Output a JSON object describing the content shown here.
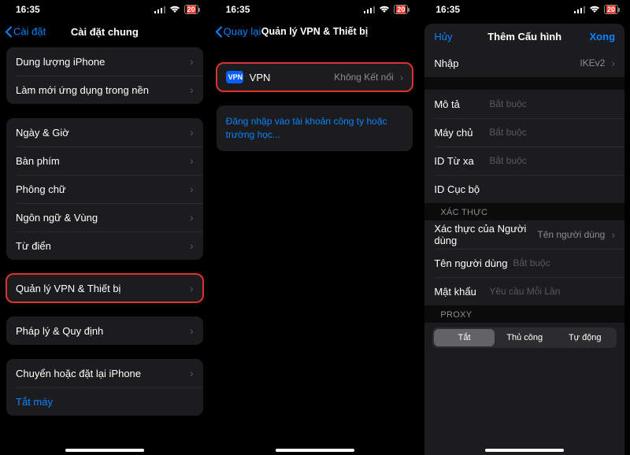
{
  "screen1": {
    "status": {
      "time": "16:35",
      "battery": "20"
    },
    "nav": {
      "back": "Cài đặt",
      "title": "Cài đặt chung"
    },
    "group1": [
      {
        "label": "Dung lượng iPhone"
      },
      {
        "label": "Làm mới ứng dụng trong nền"
      }
    ],
    "group2": [
      {
        "label": "Ngày & Giờ"
      },
      {
        "label": "Bàn phím"
      },
      {
        "label": "Phông chữ"
      },
      {
        "label": "Ngôn ngữ & Vùng"
      },
      {
        "label": "Từ điển"
      }
    ],
    "group3": [
      {
        "label": "Quản lý VPN & Thiết bị"
      }
    ],
    "group4": [
      {
        "label": "Pháp lý & Quy định"
      }
    ],
    "group5": [
      {
        "label": "Chuyển hoặc đặt lại iPhone"
      },
      {
        "label": "Tắt máy",
        "link": true
      }
    ]
  },
  "screen2": {
    "status": {
      "time": "16:35",
      "battery": "20"
    },
    "nav": {
      "back": "Quay lại",
      "title": "Quản lý VPN & Thiết bị"
    },
    "vpn": {
      "badge": "VPN",
      "label": "VPN",
      "value": "Không Kết nối"
    },
    "info": "Đăng nhập vào tài khoản công ty hoặc trường học..."
  },
  "screen3": {
    "status": {
      "time": "16:35",
      "battery": "20"
    },
    "nav": {
      "left": "Hủy",
      "title": "Thêm Cấu hình",
      "right": "Xong"
    },
    "group1": [
      {
        "label": "Nhập",
        "value": "IKEv2",
        "chevron": true
      },
      {
        "label": "Mô tả",
        "placeholder": "Bắt buộc"
      },
      {
        "label": "Máy chủ",
        "placeholder": "Bắt buộc"
      },
      {
        "label": "ID Từ xa",
        "placeholder": "Bắt buộc"
      },
      {
        "label": "ID Cục bộ",
        "placeholder": ""
      }
    ],
    "auth_header": "XÁC THỰC",
    "group2": [
      {
        "label": "Xác thực của Người dùng",
        "value": "Tên người dùng",
        "chevron": true
      },
      {
        "label": "Tên người dùng",
        "placeholder": "Bắt buộc"
      },
      {
        "label": "Mật khẩu",
        "placeholder": "Yêu cầu Mỗi Lần"
      }
    ],
    "proxy_header": "PROXY",
    "segments": [
      {
        "label": "Tắt",
        "selected": true
      },
      {
        "label": "Thủ công",
        "selected": false
      },
      {
        "label": "Tự động",
        "selected": false
      }
    ]
  }
}
